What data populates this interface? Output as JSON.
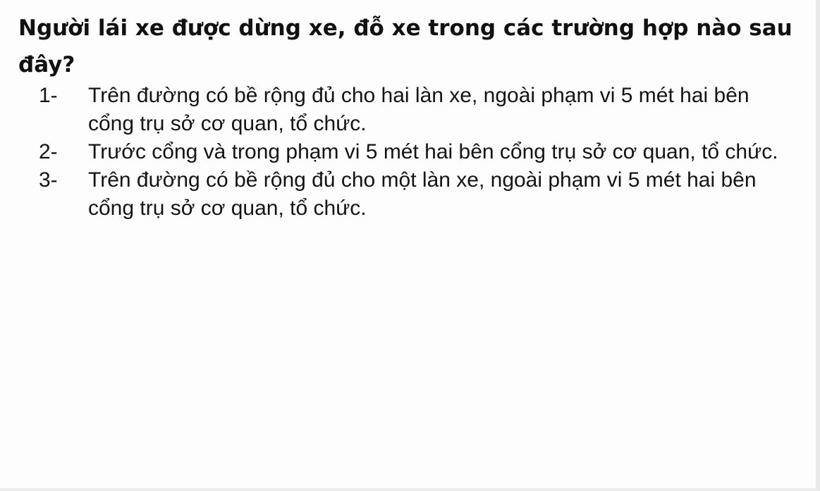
{
  "question": "Người lái xe được dừng xe, đỗ xe trong các trường hợp nào sau đây?",
  "options": [
    {
      "number": "1-",
      "text": "Trên đường có bề rộng đủ cho hai làn xe, ngoài phạm vi 5 mét hai bên cổng trụ sở cơ quan, tổ chức."
    },
    {
      "number": "2-",
      "text": "Trước cổng và trong phạm vi 5 mét hai bên cổng trụ sở cơ quan, tổ chức."
    },
    {
      "number": "3-",
      "text": "Trên đường có bề rộng đủ cho một làn xe, ngoài phạm vi 5 mét hai bên cổng trụ sở cơ quan, tổ chức."
    }
  ]
}
